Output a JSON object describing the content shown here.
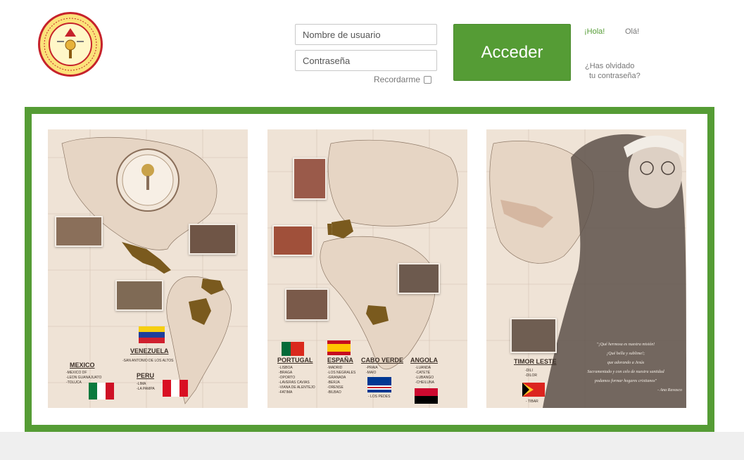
{
  "header": {
    "logo_label": "Logo Esclavas de la Santísima Eucaristía y de la Madre de Dios",
    "username_placeholder": "Nombre de usuario",
    "password_placeholder": "Contraseña",
    "remember_label": "Recordarme",
    "login_button": "Acceder",
    "lang_es": "¡Hola!",
    "lang_pt": "Olá!",
    "forgot_line1": "¿Has olvidado",
    "forgot_line2": "tu contraseña?"
  },
  "colors": {
    "accent_green": "#559c35",
    "map_bg": "#efe3d6",
    "country_brown": "#7a5a1e"
  },
  "panel1": {
    "venezuela": "VENEZUELA",
    "venezuela_city": "-SAN ANTONIO DE LOS ALTOS",
    "mexico": "MEXICO",
    "mexico_cities": [
      "-MEXICO DF",
      "-LEON GUANAJUATO",
      "-TOLUCA"
    ],
    "peru": "PERU",
    "peru_cities": [
      "-LIMA",
      "-LA PAMPA"
    ]
  },
  "panel2": {
    "portugal": "PORTUGAL",
    "portugal_cities": [
      "-LISBOA",
      "-BRAGA",
      "-OPORTO",
      "-LAVERAS CAVIAS",
      "-VIANA DE ALENTEJO",
      "-FATIMA"
    ],
    "espana": "ESPAÑA",
    "espana_cities": [
      "-MADRID",
      "-LOS NEGRALES",
      "-GRANADA",
      "-BERJA",
      "-ORENSE",
      "-BILBAO"
    ],
    "cabo_verde": "CABO VERDE",
    "cabo_verde_cities": [
      "-PRAIA",
      "-MAIO"
    ],
    "cabo_verde_extra": "- LOS PEDES",
    "angola": "ANGOLA",
    "angola_cities": [
      "-LUANDA",
      "-CATETE",
      "-LUBANGO",
      "-CHEILUNA"
    ]
  },
  "panel3": {
    "timor": "TIMOR LESTE",
    "timor_cities": [
      "-DILI",
      "-DILOR"
    ],
    "timor_extra": "- TIBAR",
    "quote_lines": [
      "\"¡Qué hermosa es nuestra misión!",
      "¡Qué bella y sublime!;",
      "que adorando a Jesús",
      "Sacramentado y con celo de nuestra santidad",
      "podamos formar hogares cristianos\"",
      "- Ana Ravasco"
    ]
  }
}
